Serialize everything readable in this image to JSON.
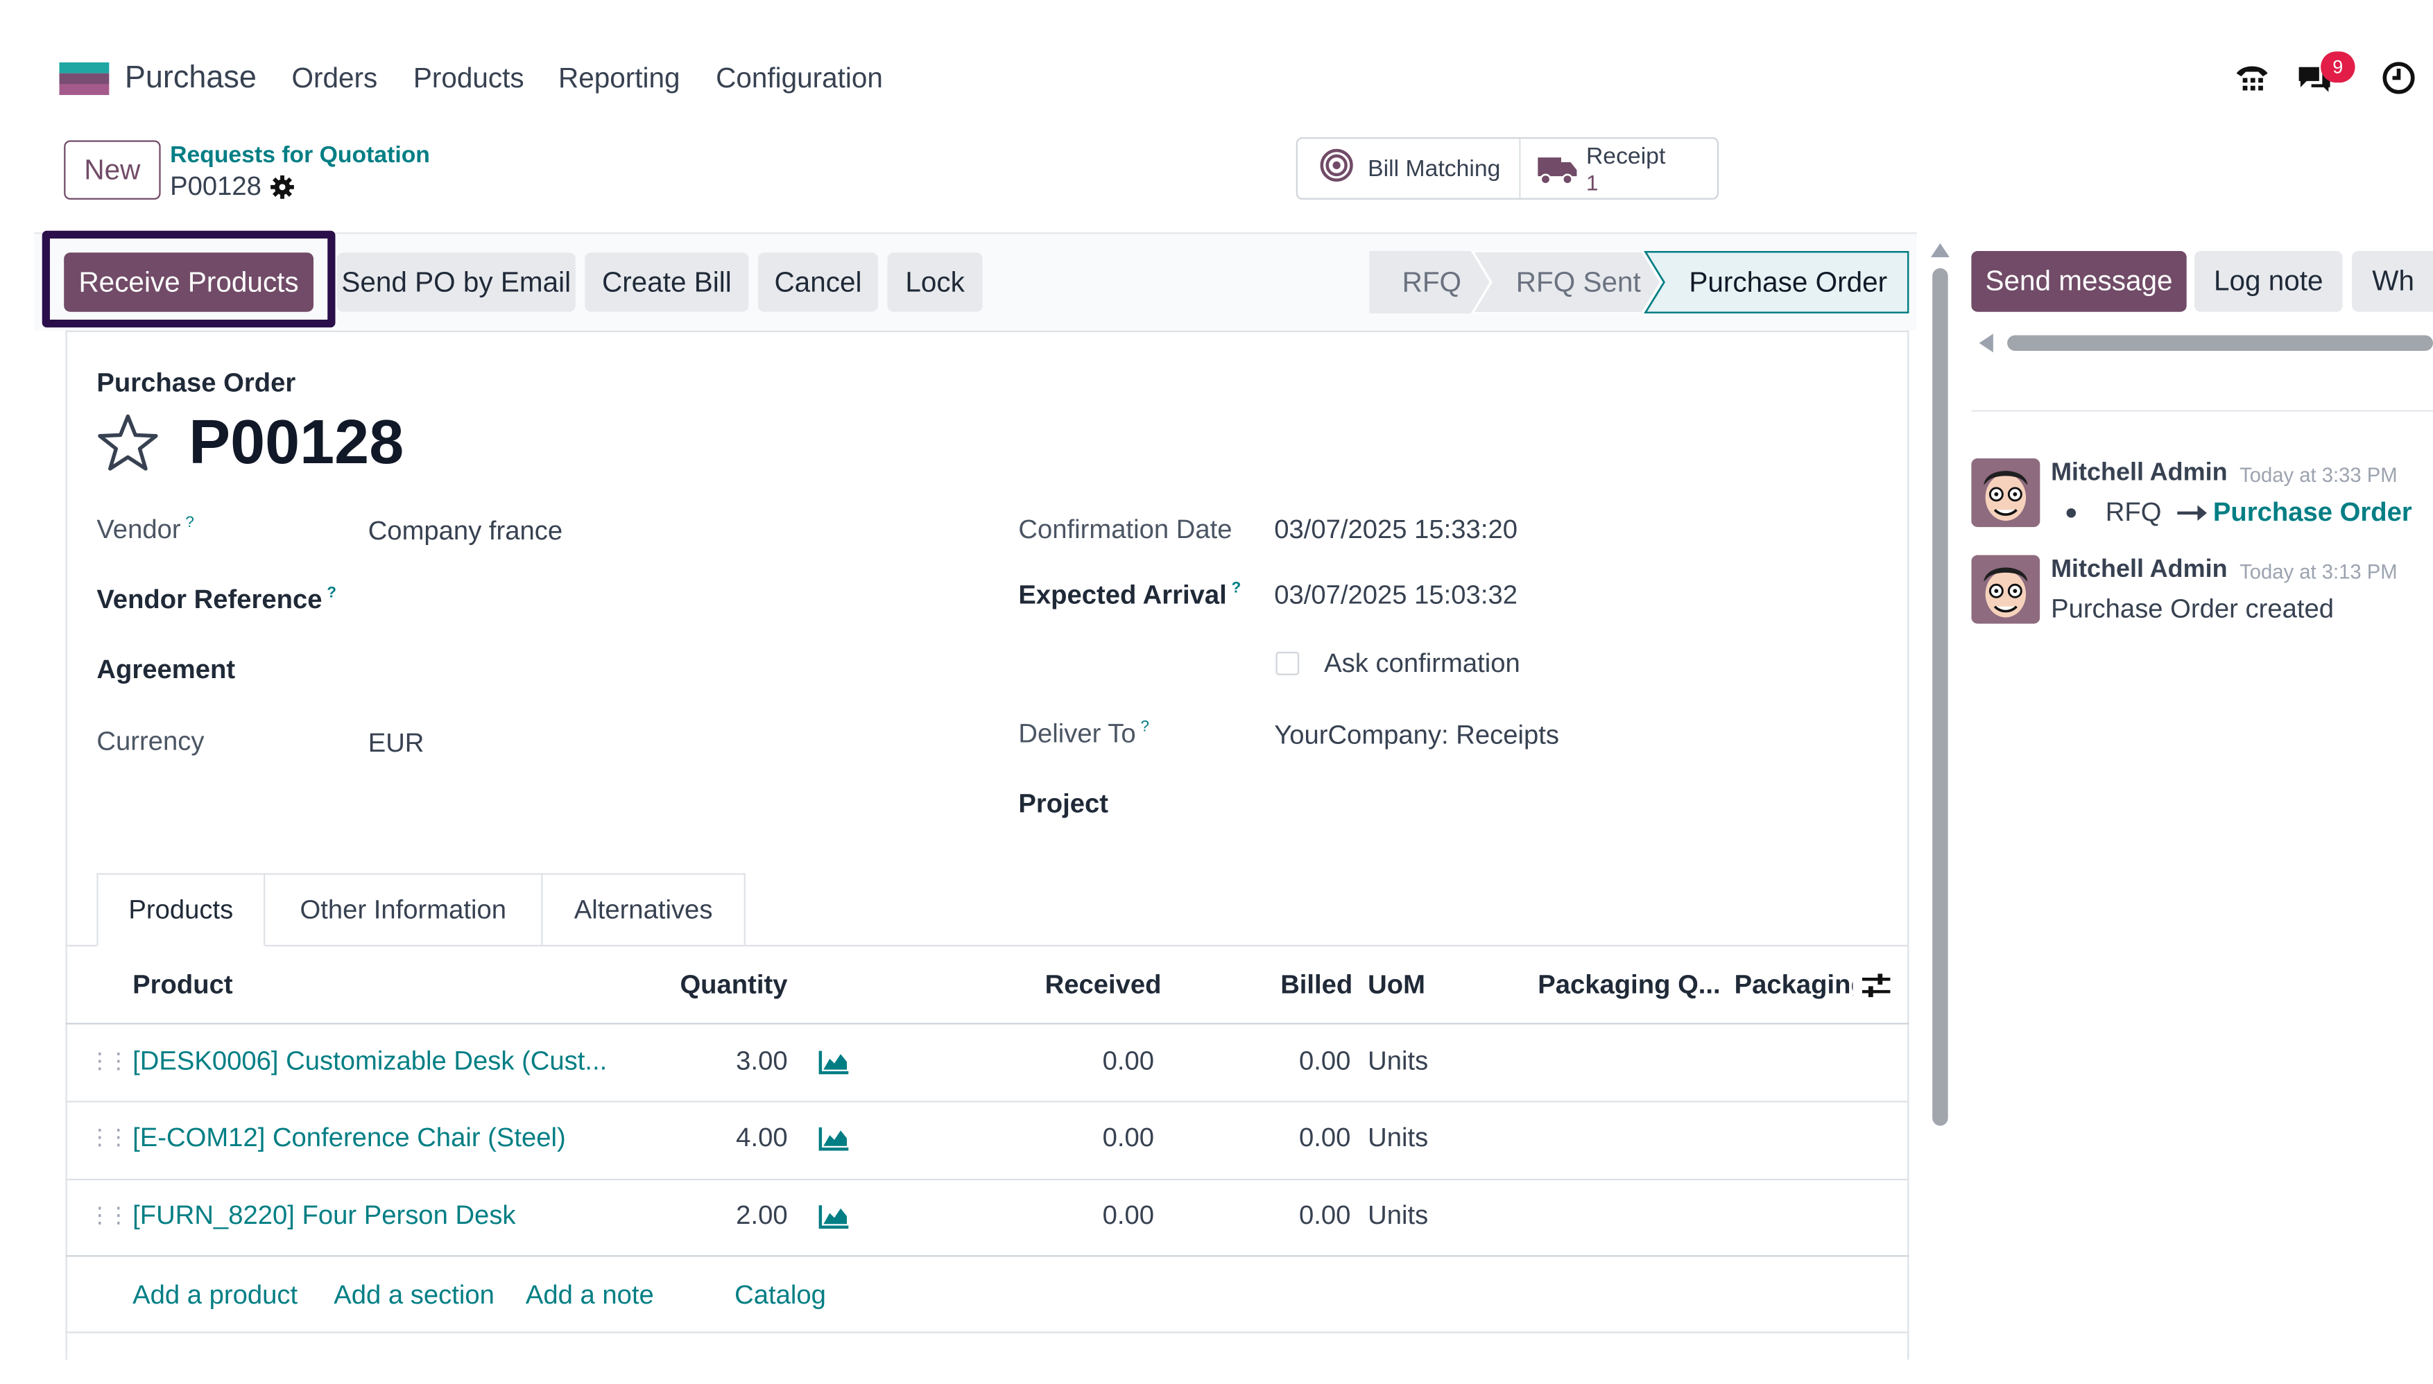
{
  "nav": {
    "app_name": "Purchase",
    "menu": [
      "Orders",
      "Products",
      "Reporting",
      "Configuration"
    ],
    "messages_badge": "9"
  },
  "control": {
    "new_label": "New",
    "breadcrumb_parent": "Requests for Quotation",
    "breadcrumb_current": "P00128"
  },
  "smart_buttons": {
    "bill_matching": "Bill Matching",
    "receipt_label": "Receipt",
    "receipt_count": "1"
  },
  "actions": {
    "receive_products": "Receive Products",
    "send_po_email": "Send PO by Email",
    "create_bill": "Create Bill",
    "cancel": "Cancel",
    "lock": "Lock"
  },
  "status": {
    "steps": [
      "RFQ",
      "RFQ Sent",
      "Purchase Order"
    ],
    "active": "Purchase Order"
  },
  "form": {
    "doc_type": "Purchase Order",
    "name": "P00128",
    "vendor_label": "Vendor",
    "vendor_value": "Company france",
    "vendor_ref_label": "Vendor Reference",
    "agreement_label": "Agreement",
    "currency_label": "Currency",
    "currency_value": "EUR",
    "confirmation_date_label": "Confirmation Date",
    "confirmation_date_value": "03/07/2025 15:33:20",
    "expected_arrival_label": "Expected Arrival",
    "expected_arrival_value": "03/07/2025 15:03:32",
    "ask_confirmation_label": "Ask confirmation",
    "deliver_to_label": "Deliver To",
    "deliver_to_value": "YourCompany: Receipts",
    "project_label": "Project",
    "help_mark": "?"
  },
  "tabs": [
    "Products",
    "Other Information",
    "Alternatives"
  ],
  "table": {
    "headers": {
      "product": "Product",
      "quantity": "Quantity",
      "received": "Received",
      "billed": "Billed",
      "uom": "UoM",
      "packaging_qty": "Packaging Q...",
      "packaging": "Packaging"
    },
    "rows": [
      {
        "product": "[DESK0006] Customizable Desk (Cust...",
        "quantity": "3.00",
        "received": "0.00",
        "billed": "0.00",
        "uom": "Units"
      },
      {
        "product": "[E-COM12] Conference Chair (Steel)",
        "quantity": "4.00",
        "received": "0.00",
        "billed": "0.00",
        "uom": "Units"
      },
      {
        "product": "[FURN_8220] Four Person Desk",
        "quantity": "2.00",
        "received": "0.00",
        "billed": "0.00",
        "uom": "Units"
      }
    ],
    "add_links": [
      "Add a product",
      "Add a section",
      "Add a note",
      "Catalog"
    ]
  },
  "chatter": {
    "send_message": "Send message",
    "log_note": "Log note",
    "third_button": "Wh",
    "messages": [
      {
        "author": "Mitchell Admin",
        "time": "Today at 3:33 PM",
        "bullet_from": "RFQ",
        "bullet_to": "Purchase Order"
      },
      {
        "author": "Mitchell Admin",
        "time": "Today at 3:13 PM",
        "body": "Purchase Order created"
      }
    ]
  },
  "colors": {
    "brand": "#714b67",
    "link": "#017e84",
    "highlight_border": "#2a0f4a"
  }
}
